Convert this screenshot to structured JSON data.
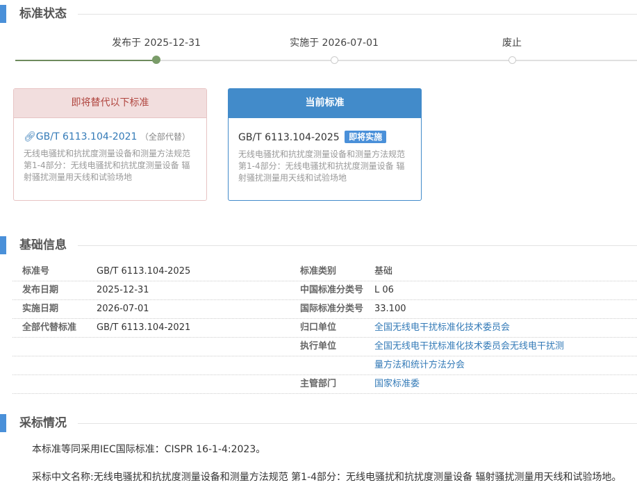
{
  "sections": {
    "status": "标准状态",
    "basic": "基础信息",
    "adoption": "采标情况"
  },
  "timeline": {
    "published": "发布于 2025-12-31",
    "implemented": "实施于 2026-07-01",
    "abolished": "废止"
  },
  "replaced_card": {
    "header": "即将替代以下标准",
    "code": "GB/T 6113.104-2021",
    "tag": "（全部代替）",
    "desc": "无线电骚扰和抗扰度测量设备和测量方法规范 第1-4部分：无线电骚扰和抗扰度测量设备 辐射骚扰测量用天线和试验场地"
  },
  "current_card": {
    "header": "当前标准",
    "code": "GB/T 6113.104-2025",
    "badge": "即将实施",
    "desc": "无线电骚扰和抗扰度测量设备和测量方法规范 第1-4部分：无线电骚扰和抗扰度测量设备 辐射骚扰测量用天线和试验场地"
  },
  "info": {
    "std_no_label": "标准号",
    "std_no": "GB/T 6113.104-2025",
    "pub_date_label": "发布日期",
    "pub_date": "2025-12-31",
    "impl_date_label": "实施日期",
    "impl_date": "2026-07-01",
    "replaces_label": "全部代替标准",
    "replaces": "GB/T 6113.104-2021",
    "category_label": "标准类别",
    "category": "基础",
    "ccs_label": "中国标准分类号",
    "ccs": "L 06",
    "ics_label": "国际标准分类号",
    "ics": "33.100",
    "owner_label": "归口单位",
    "owner": "全国无线电干扰标准化技术委员会",
    "executor_label": "执行单位",
    "executor_line1": "全国无线电干扰标准化技术委员会无线电干扰测",
    "executor_line2": "量方法和统计方法分会",
    "authority_label": "主管部门",
    "authority": "国家标准委"
  },
  "adoption": {
    "line1": "本标准等同采用IEC国际标准：CISPR 16-1-4:2023。",
    "line2": "采标中文名称:无线电骚扰和抗扰度测量设备和测量方法规范 第1-4部分：无线电骚扰和抗扰度测量设备 辐射骚扰测量用天线和试验场地。"
  }
}
